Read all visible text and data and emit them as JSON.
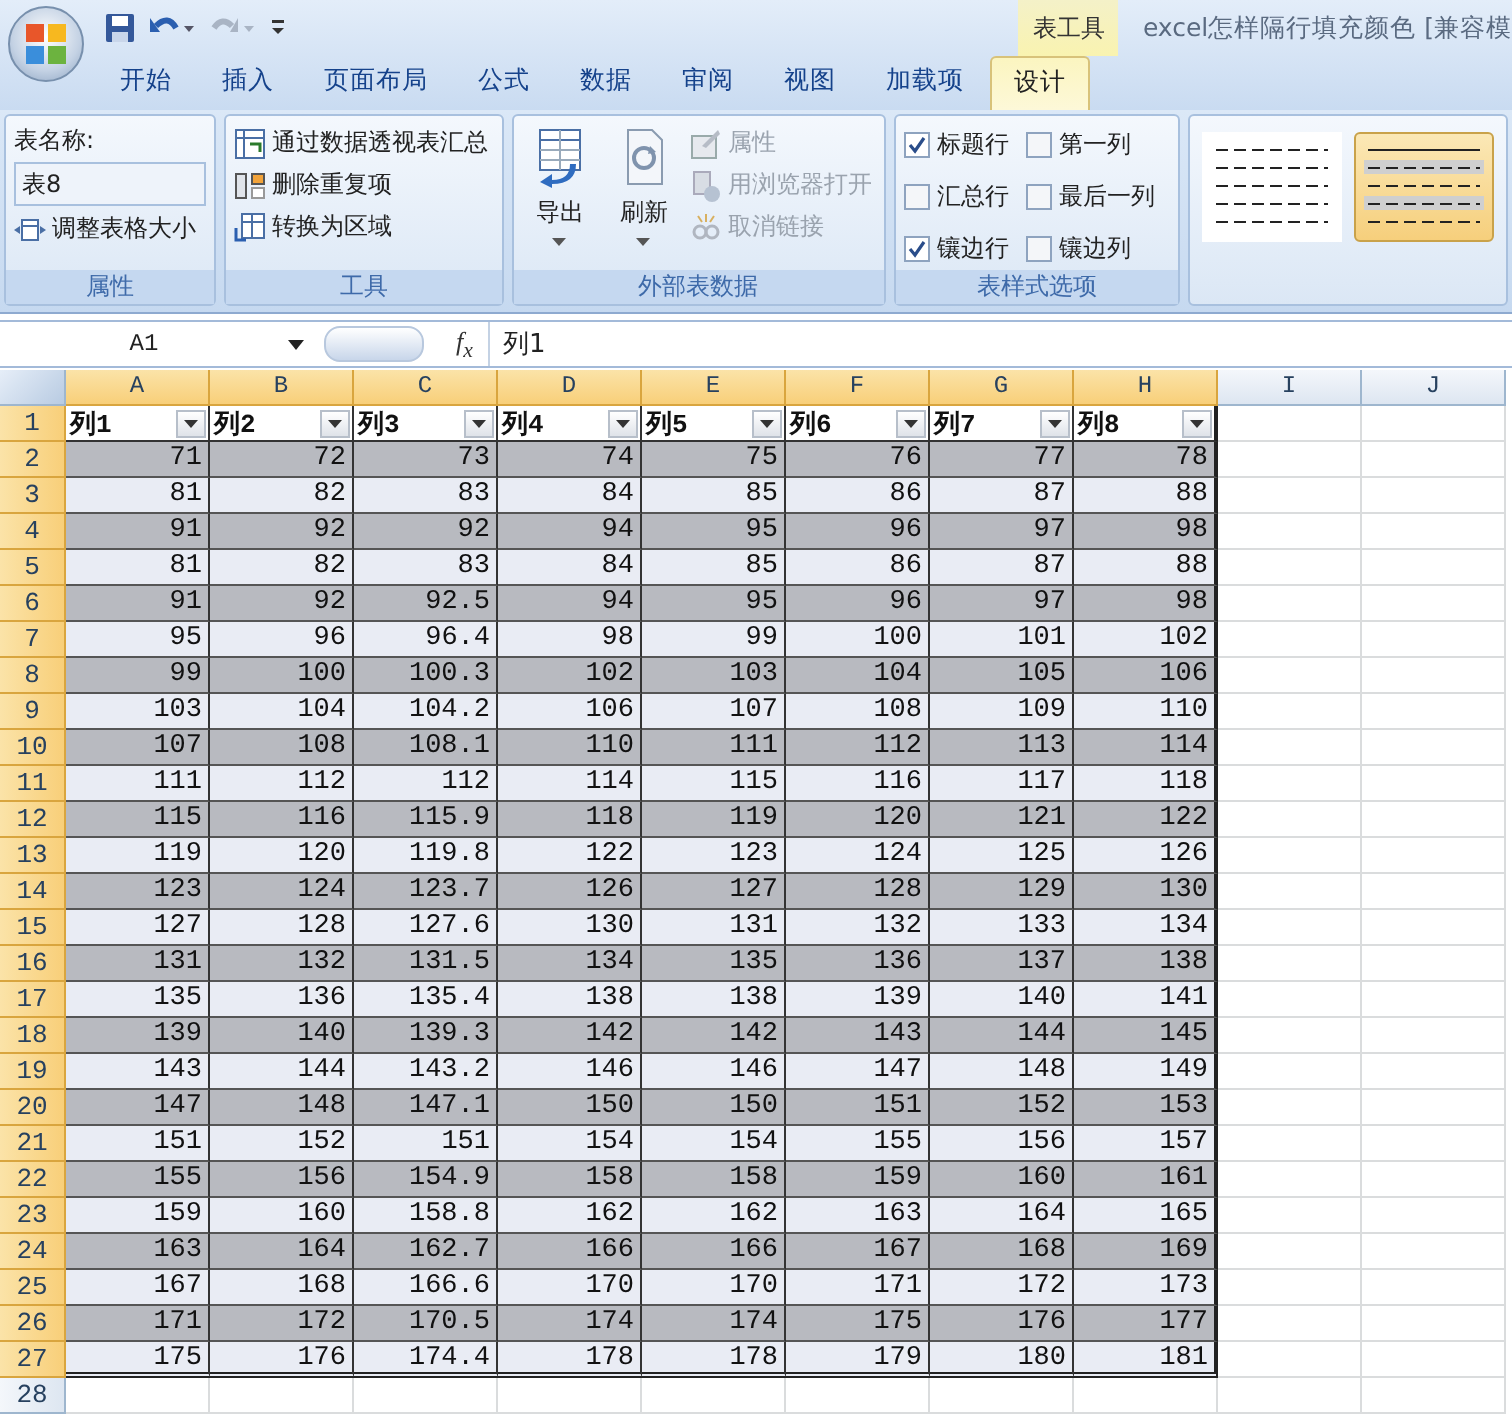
{
  "title_bar": {
    "contextual_group": "表工具",
    "title": "excel怎样隔行填充颜色  [兼容模"
  },
  "tabs": [
    {
      "label": "开始",
      "selected": false
    },
    {
      "label": "插入",
      "selected": false
    },
    {
      "label": "页面布局",
      "selected": false
    },
    {
      "label": "公式",
      "selected": false
    },
    {
      "label": "数据",
      "selected": false
    },
    {
      "label": "审阅",
      "selected": false
    },
    {
      "label": "视图",
      "selected": false
    },
    {
      "label": "加载项",
      "selected": false
    },
    {
      "label": "设计",
      "selected": true
    }
  ],
  "properties_group": {
    "name_label": "表名称:",
    "table_name": "表8",
    "resize_button": "调整表格大小",
    "label": "属性"
  },
  "tools_group": {
    "items": [
      "通过数据透视表汇总",
      "删除重复项",
      "转换为区域"
    ],
    "label": "工具"
  },
  "external_group": {
    "large_buttons": [
      {
        "label": "导出"
      },
      {
        "label": "刷新"
      }
    ],
    "small_buttons": [
      {
        "label": "属性",
        "disabled": true
      },
      {
        "label": "用浏览器打开",
        "disabled": true
      },
      {
        "label": "取消链接",
        "disabled": true
      }
    ],
    "label": "外部表数据"
  },
  "style_options_group": {
    "options": [
      {
        "kind": "header_row",
        "label": "标题行",
        "checked": true
      },
      {
        "kind": "first_column",
        "label": "第一列",
        "checked": false
      },
      {
        "kind": "total_row",
        "label": "汇总行",
        "checked": false
      },
      {
        "kind": "last_column",
        "label": "最后一列",
        "checked": false
      },
      {
        "kind": "banded_rows",
        "label": "镶边行",
        "checked": true
      },
      {
        "kind": "banded_columns",
        "label": "镶边列",
        "checked": false
      }
    ],
    "label": "表样式选项"
  },
  "styles_gallery": {
    "styles": [
      {
        "kind": "plain",
        "selected": false
      },
      {
        "kind": "banded",
        "selected": true
      }
    ]
  },
  "formula_bar": {
    "name_box": "A1",
    "function_label": "f$_{x}$",
    "formula": "列1"
  },
  "sheet": {
    "columns": [
      "A",
      "B",
      "C",
      "D",
      "E",
      "F",
      "G",
      "H",
      "I",
      "J"
    ],
    "row_numbers": [
      "1",
      "2",
      "3",
      "4",
      "5",
      "6",
      "7",
      "8",
      "9",
      "10",
      "11",
      "12",
      "13",
      "14",
      "15",
      "16",
      "17",
      "18",
      "19",
      "20",
      "21",
      "22",
      "23",
      "24",
      "25",
      "26",
      "27",
      "28"
    ],
    "header_row": [
      "列1",
      "列2",
      "列3",
      "列4",
      "列5",
      "列6",
      "列7",
      "列8"
    ],
    "rows": [
      [
        "71",
        "72",
        "73",
        "74",
        "75",
        "76",
        "77",
        "78"
      ],
      [
        "81",
        "82",
        "83",
        "84",
        "85",
        "86",
        "87",
        "88"
      ],
      [
        "91",
        "92",
        "92",
        "94",
        "95",
        "96",
        "97",
        "98"
      ],
      [
        "81",
        "82",
        "83",
        "84",
        "85",
        "86",
        "87",
        "88"
      ],
      [
        "91",
        "92",
        "92.5",
        "94",
        "95",
        "96",
        "97",
        "98"
      ],
      [
        "95",
        "96",
        "96.4",
        "98",
        "99",
        "100",
        "101",
        "102"
      ],
      [
        "99",
        "100",
        "100.3",
        "102",
        "103",
        "104",
        "105",
        "106"
      ],
      [
        "103",
        "104",
        "104.2",
        "106",
        "107",
        "108",
        "109",
        "110"
      ],
      [
        "107",
        "108",
        "108.1",
        "110",
        "111",
        "112",
        "113",
        "114"
      ],
      [
        "111",
        "112",
        "112",
        "114",
        "115",
        "116",
        "117",
        "118"
      ],
      [
        "115",
        "116",
        "115.9",
        "118",
        "119",
        "120",
        "121",
        "122"
      ],
      [
        "119",
        "120",
        "119.8",
        "122",
        "123",
        "124",
        "125",
        "126"
      ],
      [
        "123",
        "124",
        "123.7",
        "126",
        "127",
        "128",
        "129",
        "130"
      ],
      [
        "127",
        "128",
        "127.6",
        "130",
        "131",
        "132",
        "133",
        "134"
      ],
      [
        "131",
        "132",
        "131.5",
        "134",
        "135",
        "136",
        "137",
        "138"
      ],
      [
        "135",
        "136",
        "135.4",
        "138",
        "138",
        "139",
        "140",
        "141"
      ],
      [
        "139",
        "140",
        "139.3",
        "142",
        "142",
        "143",
        "144",
        "145"
      ],
      [
        "143",
        "144",
        "143.2",
        "146",
        "146",
        "147",
        "148",
        "149"
      ],
      [
        "147",
        "148",
        "147.1",
        "150",
        "150",
        "151",
        "152",
        "153"
      ],
      [
        "151",
        "152",
        "151",
        "154",
        "154",
        "155",
        "156",
        "157"
      ],
      [
        "155",
        "156",
        "154.9",
        "158",
        "158",
        "159",
        "160",
        "161"
      ],
      [
        "159",
        "160",
        "158.8",
        "162",
        "162",
        "163",
        "164",
        "165"
      ],
      [
        "163",
        "164",
        "162.7",
        "166",
        "166",
        "167",
        "168",
        "169"
      ],
      [
        "167",
        "168",
        "166.6",
        "170",
        "170",
        "171",
        "172",
        "173"
      ],
      [
        "171",
        "172",
        "170.5",
        "174",
        "174",
        "175",
        "176",
        "177"
      ],
      [
        "175",
        "176",
        "174.4",
        "178",
        "178",
        "179",
        "180",
        "181"
      ]
    ]
  }
}
